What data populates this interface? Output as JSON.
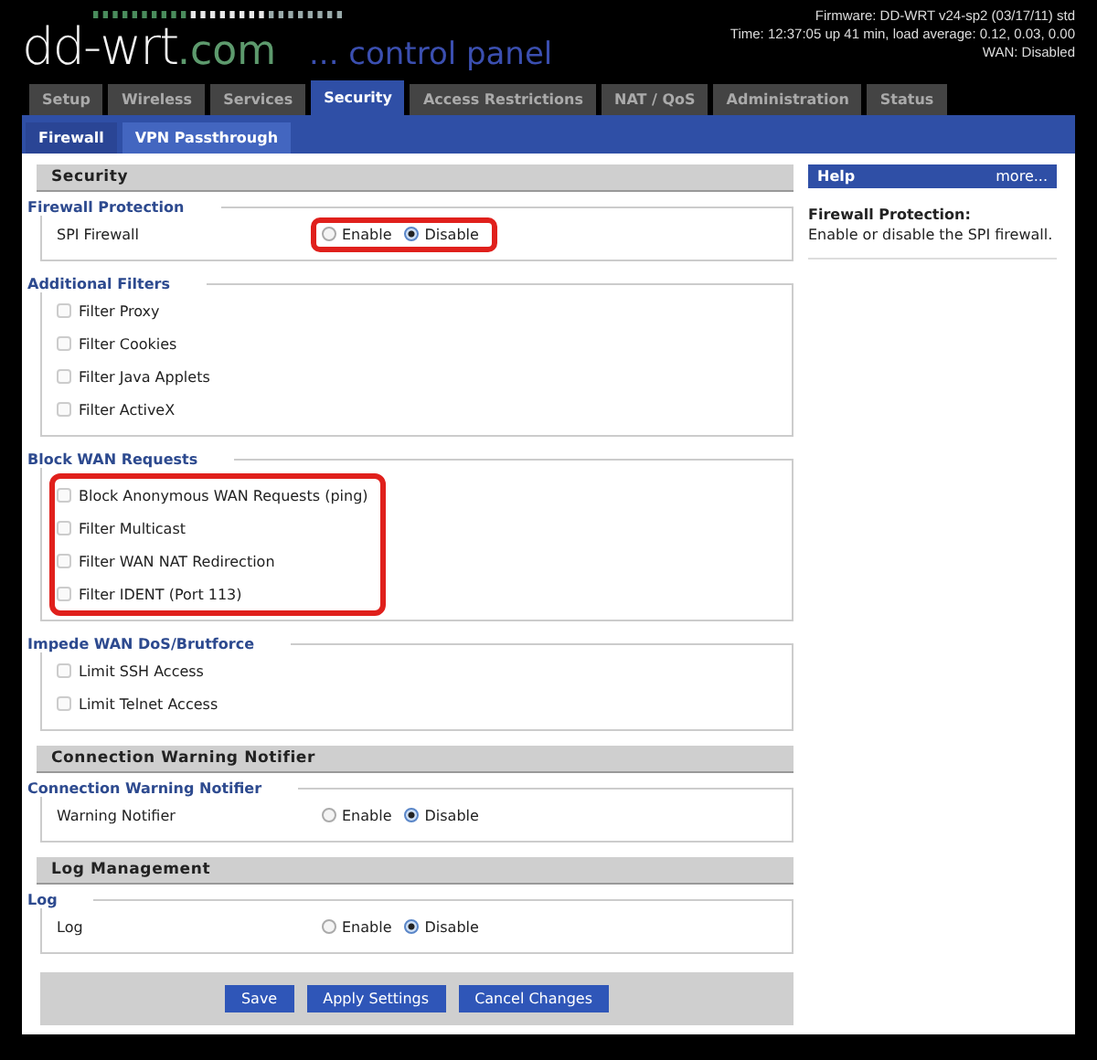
{
  "header": {
    "logo_name": "dd-wrt",
    "logo_domain": ".com",
    "tagline": "... control panel",
    "info": [
      "Firmware: DD-WRT v24-sp2 (03/17/11) std",
      "Time: 12:37:05 up 41 min, load average: 0.12, 0.03, 0.00",
      "WAN: Disabled"
    ]
  },
  "tabs": [
    {
      "label": "Setup",
      "selected": false
    },
    {
      "label": "Wireless",
      "selected": false
    },
    {
      "label": "Services",
      "selected": false
    },
    {
      "label": "Security",
      "selected": true
    },
    {
      "label": "Access Restrictions",
      "selected": false
    },
    {
      "label": "NAT / QoS",
      "selected": false
    },
    {
      "label": "Administration",
      "selected": false
    },
    {
      "label": "Status",
      "selected": false
    }
  ],
  "subtabs": [
    {
      "label": "Firewall",
      "selected": true
    },
    {
      "label": "VPN Passthrough",
      "selected": false
    }
  ],
  "sections": [
    {
      "title": "Security",
      "groups": [
        {
          "legend": "Firewall Protection",
          "highlighted": false,
          "rows": [
            {
              "kind": "radio",
              "label": "SPI Firewall",
              "highlighted": true,
              "options": [
                {
                  "label": "Enable",
                  "selected": false
                },
                {
                  "label": "Disable",
                  "selected": true
                }
              ]
            }
          ]
        },
        {
          "legend": "Additional Filters",
          "highlighted": false,
          "rows": [
            {
              "kind": "checkbox",
              "label": "Filter Proxy",
              "checked": false
            },
            {
              "kind": "checkbox",
              "label": "Filter Cookies",
              "checked": false
            },
            {
              "kind": "checkbox",
              "label": "Filter Java Applets",
              "checked": false
            },
            {
              "kind": "checkbox",
              "label": "Filter ActiveX",
              "checked": false
            }
          ]
        },
        {
          "legend": "Block WAN Requests",
          "highlighted": true,
          "rows": [
            {
              "kind": "checkbox",
              "label": "Block Anonymous WAN Requests (ping)",
              "checked": false
            },
            {
              "kind": "checkbox",
              "label": "Filter Multicast",
              "checked": false
            },
            {
              "kind": "checkbox",
              "label": "Filter WAN NAT Redirection",
              "checked": false
            },
            {
              "kind": "checkbox",
              "label": "Filter IDENT (Port 113)",
              "checked": false
            }
          ]
        },
        {
          "legend": "Impede WAN DoS/Brutforce",
          "highlighted": false,
          "rows": [
            {
              "kind": "checkbox",
              "label": "Limit SSH Access",
              "checked": false
            },
            {
              "kind": "checkbox",
              "label": "Limit Telnet Access",
              "checked": false
            }
          ]
        }
      ]
    },
    {
      "title": "Connection Warning Notifier",
      "groups": [
        {
          "legend": "Connection Warning Notifier",
          "highlighted": false,
          "rows": [
            {
              "kind": "radio",
              "label": "Warning Notifier",
              "highlighted": false,
              "options": [
                {
                  "label": "Enable",
                  "selected": false
                },
                {
                  "label": "Disable",
                  "selected": true
                }
              ]
            }
          ]
        }
      ]
    },
    {
      "title": "Log Management",
      "groups": [
        {
          "legend": "Log",
          "highlighted": false,
          "rows": [
            {
              "kind": "radio",
              "label": "Log",
              "highlighted": false,
              "options": [
                {
                  "label": "Enable",
                  "selected": false
                },
                {
                  "label": "Disable",
                  "selected": true
                }
              ]
            }
          ]
        }
      ]
    }
  ],
  "help": {
    "title": "Help",
    "more": "more...",
    "heading": "Firewall Protection:",
    "text": "Enable or disable the SPI firewall."
  },
  "buttons": [
    "Save",
    "Apply Settings",
    "Cancel Changes"
  ]
}
